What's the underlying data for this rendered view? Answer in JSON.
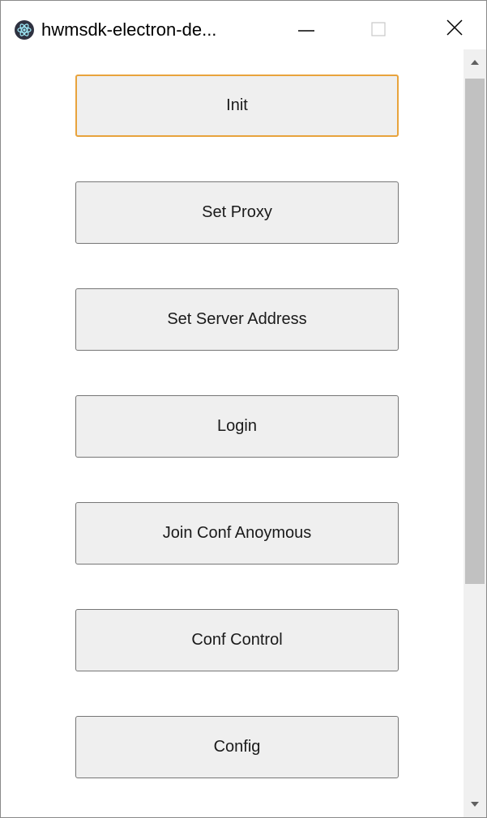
{
  "window": {
    "title": "hwmsdk-electron-de...",
    "app_icon": "electron-icon",
    "controls": {
      "minimize_icon": "minimize-icon",
      "maximize_icon": "maximize-icon",
      "close_icon": "close-icon"
    }
  },
  "buttons": {
    "init": "Init",
    "set_proxy": "Set Proxy",
    "set_server_address": "Set Server Address",
    "login": "Login",
    "join_conf_anonymous": "Join Conf Anoymous",
    "conf_control": "Conf Control",
    "config": "Config"
  },
  "colors": {
    "focus_border": "#e8a33c",
    "button_bg": "#efefef",
    "button_border": "#767676"
  },
  "scrollbar": {
    "up_icon": "scroll-up-arrow-icon",
    "down_icon": "scroll-down-arrow-icon"
  }
}
